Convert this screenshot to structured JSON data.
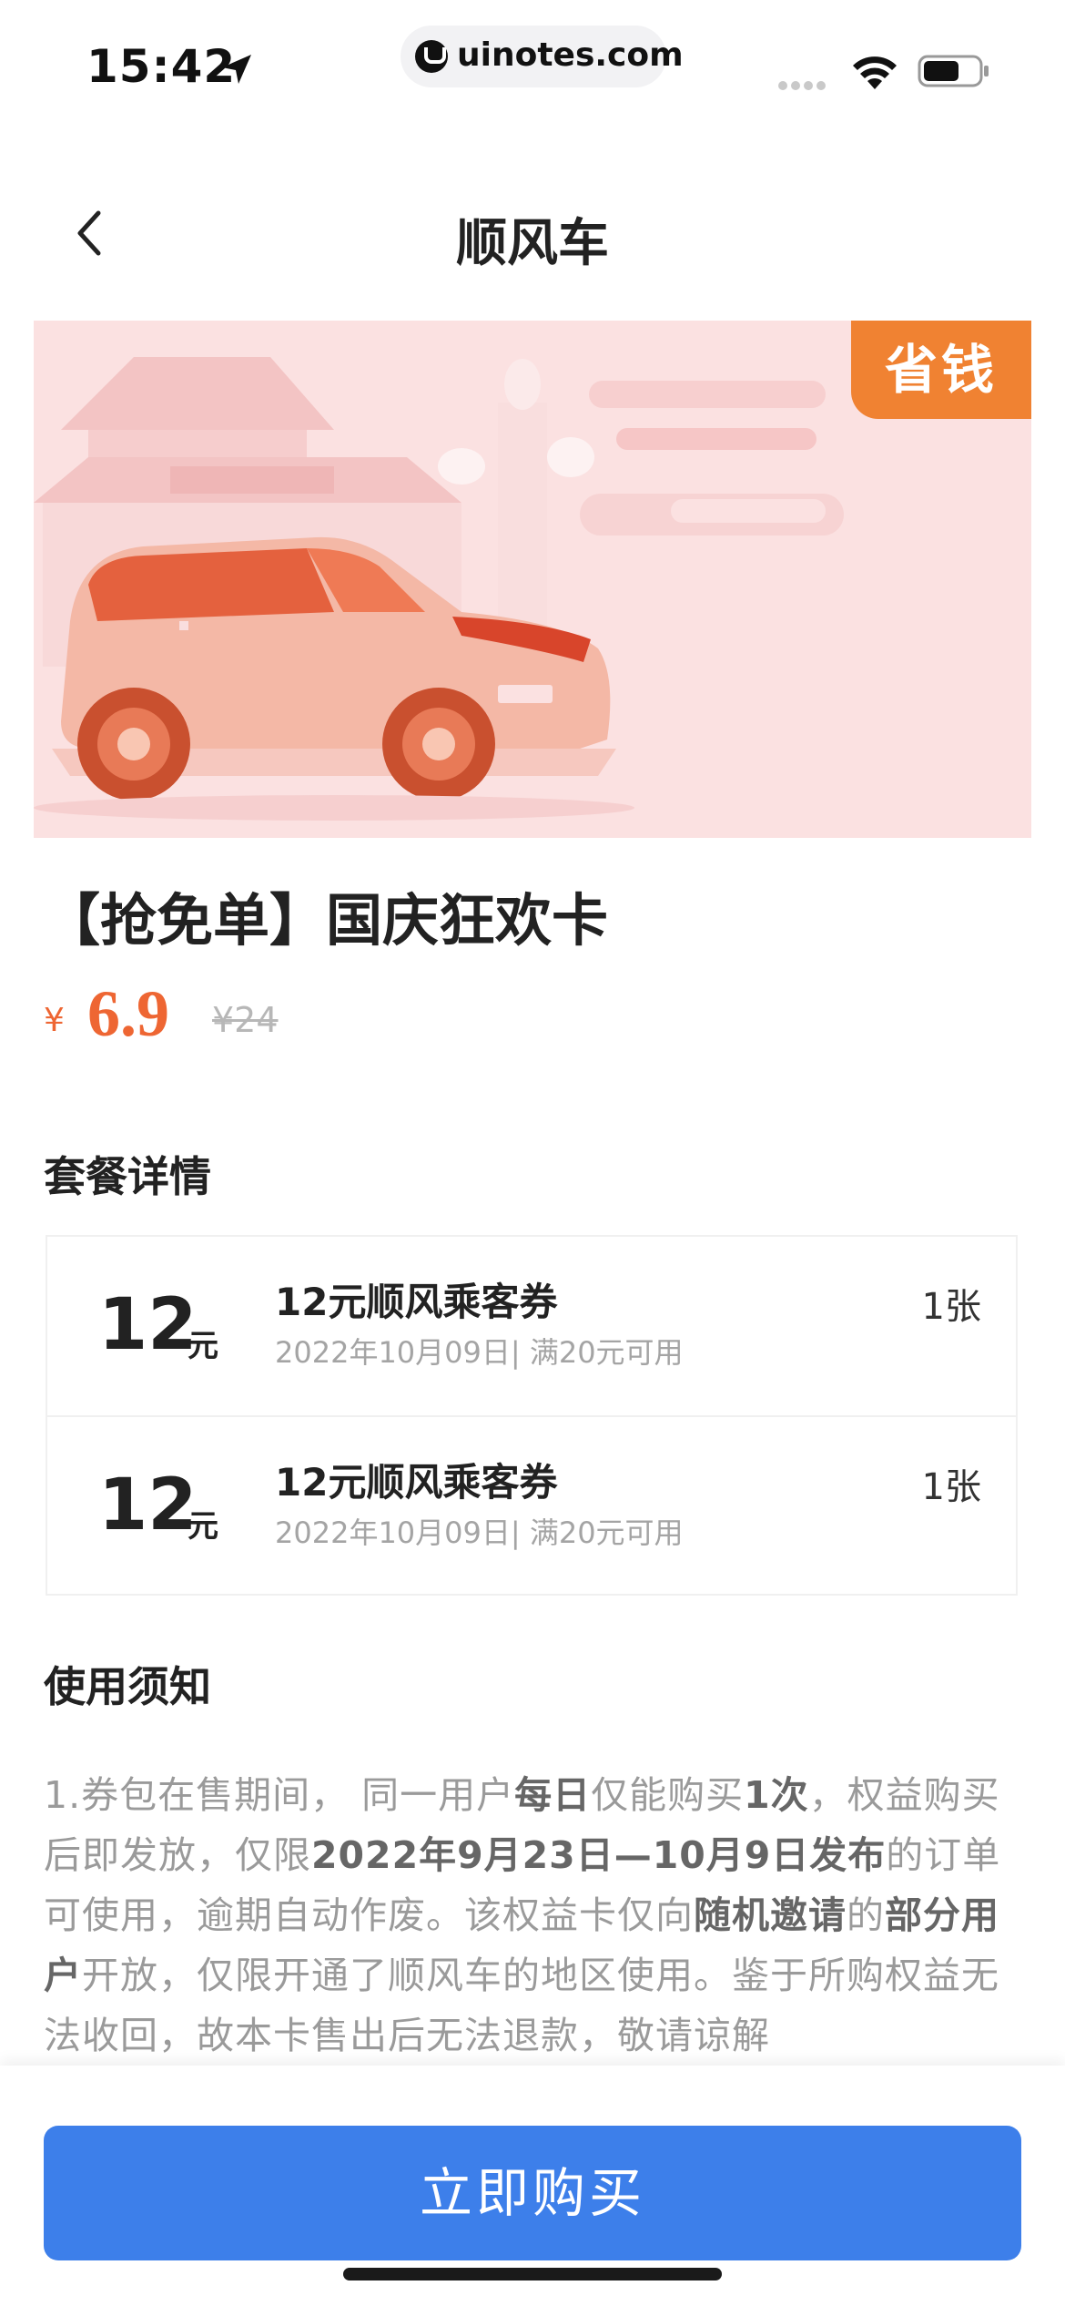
{
  "status_bar": {
    "time": "15:42",
    "url": "uinotes.com",
    "icons": [
      "location-arrow-icon",
      "wifi-icon",
      "battery-icon"
    ]
  },
  "nav": {
    "title": "顺风车",
    "back_icon": "chevron-left-icon"
  },
  "banner": {
    "badge": "省钱",
    "badge_color": "#f08232",
    "background_color": "#fbe1e1"
  },
  "product": {
    "title": "【抢免单】国庆狂欢卡",
    "price_symbol": "¥",
    "price": "6.9",
    "original_price": "¥24",
    "price_color": "#ee6633"
  },
  "package": {
    "heading": "套餐详情",
    "items": [
      {
        "amount": "12",
        "unit": "元",
        "name": "12元顺风乘客券",
        "desc": "2022年10月09日| 满20元可用",
        "count": "1张"
      },
      {
        "amount": "12",
        "unit": "元",
        "name": "12元顺风乘客券",
        "desc": "2022年10月09日| 满20元可用",
        "count": "1张"
      }
    ]
  },
  "notes": {
    "heading": "使用须知",
    "segments": [
      {
        "text": "1.券包在售期间， 同一用户",
        "bold": false
      },
      {
        "text": "每日",
        "bold": true
      },
      {
        "text": "仅能购买",
        "bold": false
      },
      {
        "text": "1次",
        "bold": true
      },
      {
        "text": "，权益购买后即发放，仅限",
        "bold": false
      },
      {
        "text": "2022年9月23日—10月9日发布",
        "bold": true
      },
      {
        "text": "的订单可使用，逾期自动作废。该权益卡仅向",
        "bold": false
      },
      {
        "text": "随机邀请",
        "bold": true
      },
      {
        "text": "的",
        "bold": false
      },
      {
        "text": "部分用户",
        "bold": true
      },
      {
        "text": "开放，仅限开通了顺风车的地区使用。鉴于所购权益无法收回，故本卡售出后无法退款，敬请谅解",
        "bold": false
      }
    ]
  },
  "footer": {
    "buy_label": "立即购买",
    "button_color": "#3d7fea"
  }
}
